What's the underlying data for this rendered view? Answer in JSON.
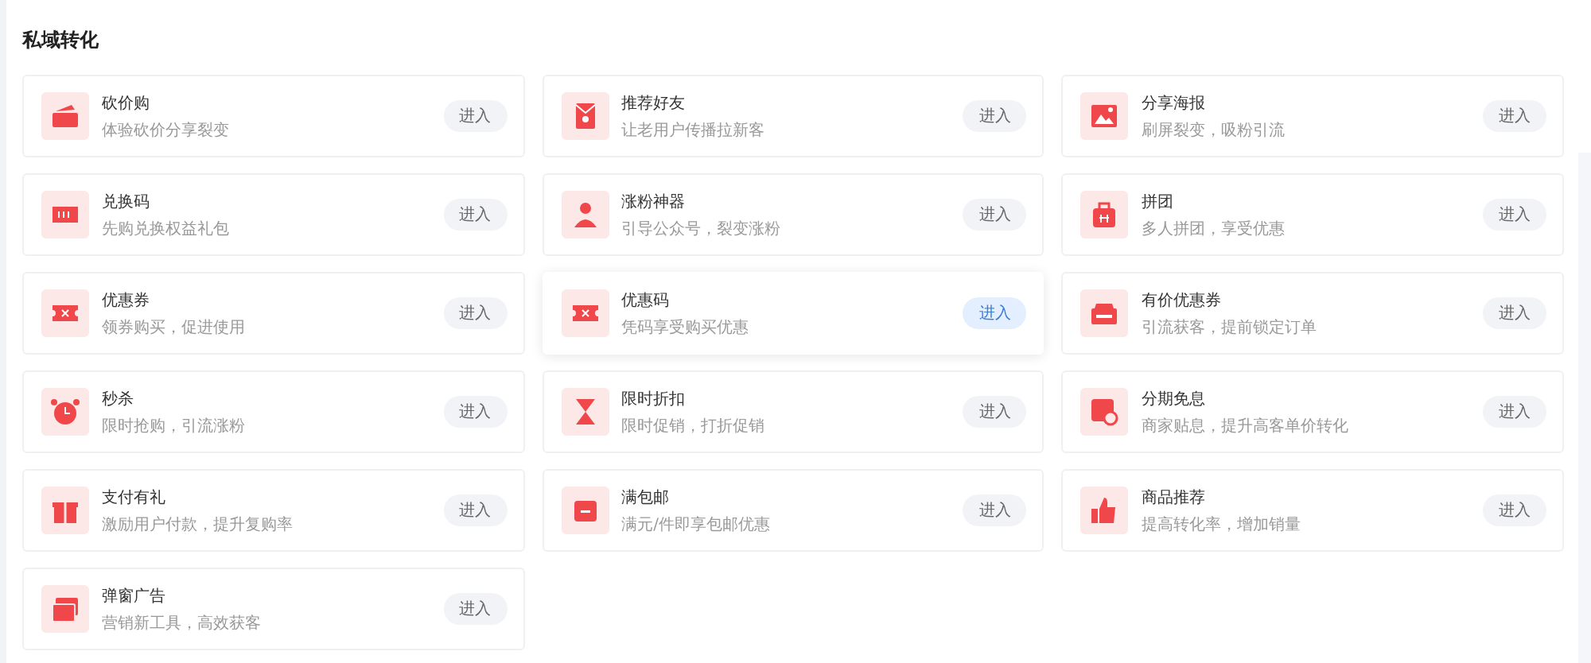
{
  "section": {
    "title": "私域转化"
  },
  "tools": [
    {
      "name": "砍价购",
      "desc": "体验砍价分享裂变",
      "button": "进入",
      "selected": false
    },
    {
      "name": "推荐好友",
      "desc": "让老用户传播拉新客",
      "button": "进入",
      "selected": false
    },
    {
      "name": "分享海报",
      "desc": "刷屏裂变，吸粉引流",
      "button": "进入",
      "selected": false
    },
    {
      "name": "兑换码",
      "desc": "先购兑换权益礼包",
      "button": "进入",
      "selected": false
    },
    {
      "name": "涨粉神器",
      "desc": "引导公众号，裂变涨粉",
      "button": "进入",
      "selected": false
    },
    {
      "name": "拼团",
      "desc": "多人拼团，享受优惠",
      "button": "进入",
      "selected": false
    },
    {
      "name": "优惠券",
      "desc": "领券购买，促进使用",
      "button": "进入",
      "selected": false
    },
    {
      "name": "优惠码",
      "desc": "凭码享受购买优惠",
      "button": "进入",
      "selected": true
    },
    {
      "name": "有价优惠券",
      "desc": "引流获客，提前锁定订单",
      "button": "进入",
      "selected": false
    },
    {
      "name": "秒杀",
      "desc": "限时抢购，引流涨粉",
      "button": "进入",
      "selected": false
    },
    {
      "name": "限时折扣",
      "desc": "限时促销，打折促销",
      "button": "进入",
      "selected": false
    },
    {
      "name": "分期免息",
      "desc": "商家贴息，提升高客单价转化",
      "button": "进入",
      "selected": false
    },
    {
      "name": "支付有礼",
      "desc": "激励用户付款，提升复购率",
      "button": "进入",
      "selected": false
    },
    {
      "name": "满包邮",
      "desc": "满元/件即享包邮优惠",
      "button": "进入",
      "selected": false
    },
    {
      "name": "商品推荐",
      "desc": "提高转化率，增加销量",
      "button": "进入",
      "selected": false
    },
    {
      "name": "弹窗广告",
      "desc": "营销新工具，高效获客",
      "button": "进入",
      "selected": false
    }
  ]
}
